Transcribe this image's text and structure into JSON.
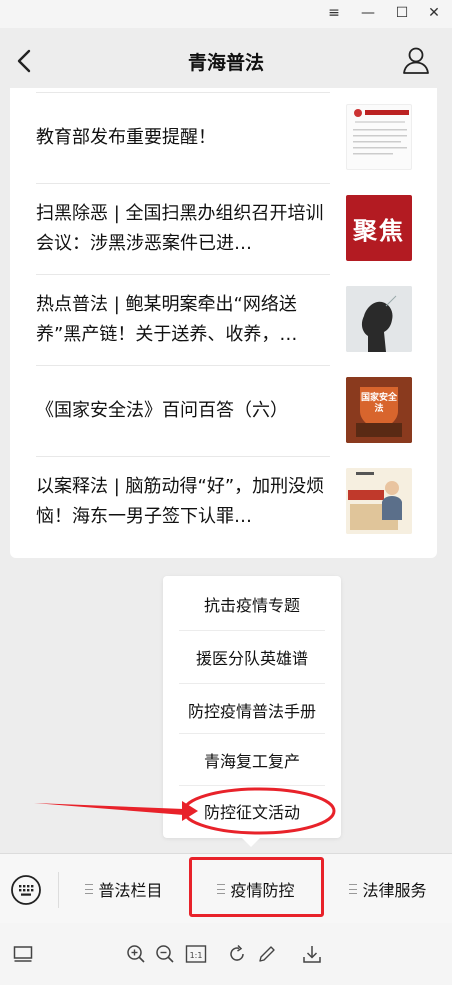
{
  "window": {
    "controls": [
      "≡",
      "—",
      "☐",
      "✕"
    ]
  },
  "header": {
    "title": "青海普法"
  },
  "articles": [
    {
      "title": "教育部发布重要提醒！",
      "thumb": "doc"
    },
    {
      "title": "扫黑除恶 | 全国扫黑办组织召开培训会议：涉黑涉恶案件已进…",
      "thumb": "jujiao",
      "thumb_text": "聚焦"
    },
    {
      "title": "热点普法 | 鲍某明案牵出“网络送养”黑产链！关于送养、收养，…",
      "thumb": "silhouette"
    },
    {
      "title": "《国家安全法》百问百答（六）",
      "thumb": "law",
      "thumb_text": "国家安全法"
    },
    {
      "title": "以案释法 | 脑筋动得“好”，加刑没烦恼！海东一男子签下认罪…",
      "thumb": "cartoon"
    }
  ],
  "submenu": {
    "items": [
      "抗击疫情专题",
      "援医分队英雄谱",
      "防控疫情普法手册",
      "青海复工复产",
      "防控征文活动"
    ]
  },
  "bottom_menu": {
    "items": [
      "普法栏目",
      "疫情防控",
      "法律服务"
    ]
  },
  "colors": {
    "annotation_red": "#e8222a",
    "background": "#ededed"
  }
}
